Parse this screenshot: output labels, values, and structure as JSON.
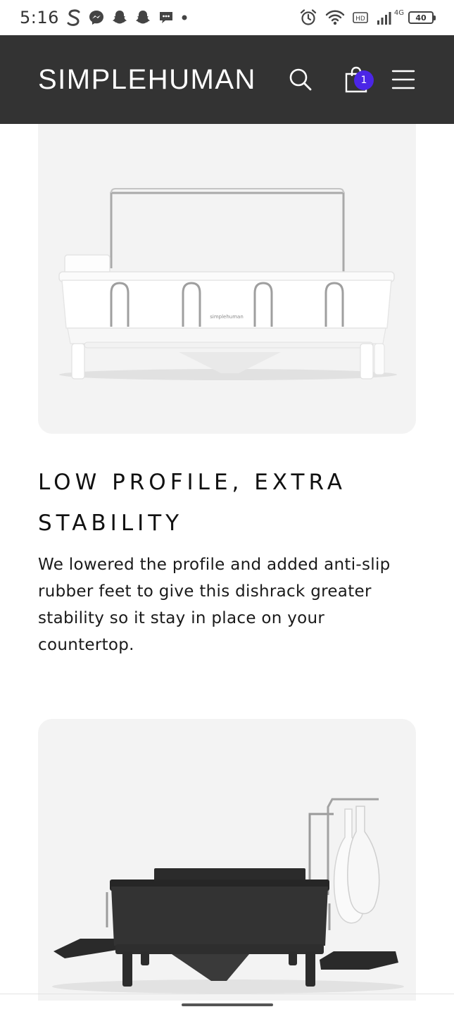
{
  "status_bar": {
    "time": "5:16",
    "network_label": "4G",
    "battery": "40",
    "icons": [
      "s-app-icon",
      "messenger-icon",
      "snapchat-icon",
      "snapchat-icon",
      "chat-bubble-icon",
      "dot-icon",
      "alarm-icon",
      "wifi-icon",
      "hd-icon",
      "signal-icon",
      "battery-icon"
    ]
  },
  "header": {
    "logo": "SIMPLEHUMAN",
    "cart_count": "1",
    "background": "#333333",
    "badge_color": "#4b25e6"
  },
  "feature": {
    "title": "LOW PROFILE, EXTRA STABILITY",
    "body": "We lowered the profile and added anti-slip rubber feet to give this dishrack greater stability so it stay in place on your countertop."
  },
  "products": {
    "white_rack_brand": "simplehuman"
  }
}
